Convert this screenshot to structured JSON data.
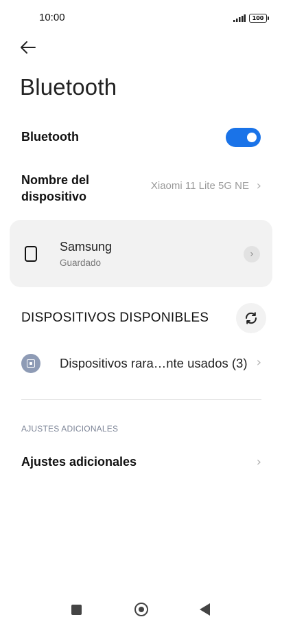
{
  "status_bar": {
    "time": "10:00",
    "battery": "100"
  },
  "header": {
    "title": "Bluetooth"
  },
  "bluetooth_toggle": {
    "label": "Bluetooth",
    "enabled": true
  },
  "device_name": {
    "label": "Nombre del dispositivo",
    "value": "Xiaomi 11 Lite 5G NE"
  },
  "saved_device": {
    "name": "Samsung",
    "status": "Guardado"
  },
  "available_section": {
    "title": "DISPOSITIVOS DISPONIBLES"
  },
  "rare_devices": {
    "label": "Dispositivos rara…nte usados (3)"
  },
  "additional": {
    "section_header": "AJUSTES ADICIONALES",
    "label": "Ajustes adicionales"
  },
  "icons": {
    "back": "arrow-left-icon",
    "refresh": "refresh-icon",
    "device": "phone-outline-icon",
    "rare": "device-badge-icon",
    "chevron": "chevron-right-icon"
  },
  "colors": {
    "accent": "#1a73e8",
    "card_bg": "#f2f2f2",
    "section_header": "#7d8597"
  }
}
